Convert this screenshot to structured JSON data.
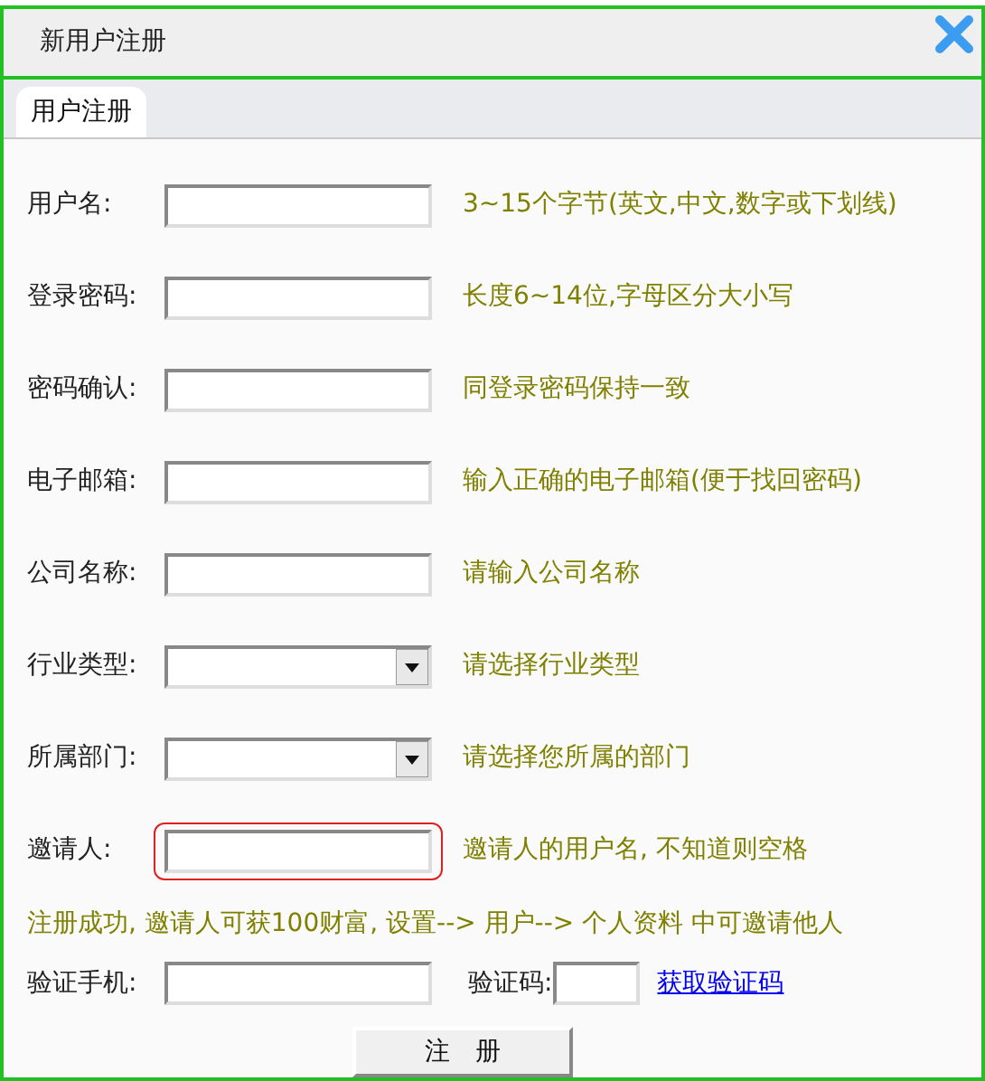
{
  "window": {
    "title": "新用户注册"
  },
  "tabs": [
    {
      "label": "用户注册",
      "selected": true
    }
  ],
  "fields": [
    {
      "kind": "text",
      "label": "用户名:",
      "hint": "3~15个字节(英文,中文,数字或下划线)",
      "highlighted": false
    },
    {
      "kind": "text",
      "label": "登录密码:",
      "hint": "长度6~14位,字母区分大小写",
      "highlighted": false
    },
    {
      "kind": "text",
      "label": "密码确认:",
      "hint": "同登录密码保持一致",
      "highlighted": false
    },
    {
      "kind": "text",
      "label": "电子邮箱:",
      "hint": "输入正确的电子邮箱(便于找回密码)",
      "highlighted": false
    },
    {
      "kind": "text",
      "label": "公司名称:",
      "hint": "请输入公司名称",
      "highlighted": false
    },
    {
      "kind": "select",
      "label": "行业类型:",
      "hint": "请选择行业类型",
      "highlighted": false
    },
    {
      "kind": "select",
      "label": "所属部门:",
      "hint": "请选择您所属的部门",
      "highlighted": false
    },
    {
      "kind": "text",
      "label": "邀请人:",
      "hint": "邀请人的用户名, 不知道则空格",
      "highlighted": true
    }
  ],
  "note": "注册成功, 邀请人可获100财富, 设置--> 用户--> 个人资料  中可邀请他人",
  "phone": {
    "label": "验证手机:",
    "code_label": "验证码:",
    "link": "获取验证码"
  },
  "submit": "注　册"
}
